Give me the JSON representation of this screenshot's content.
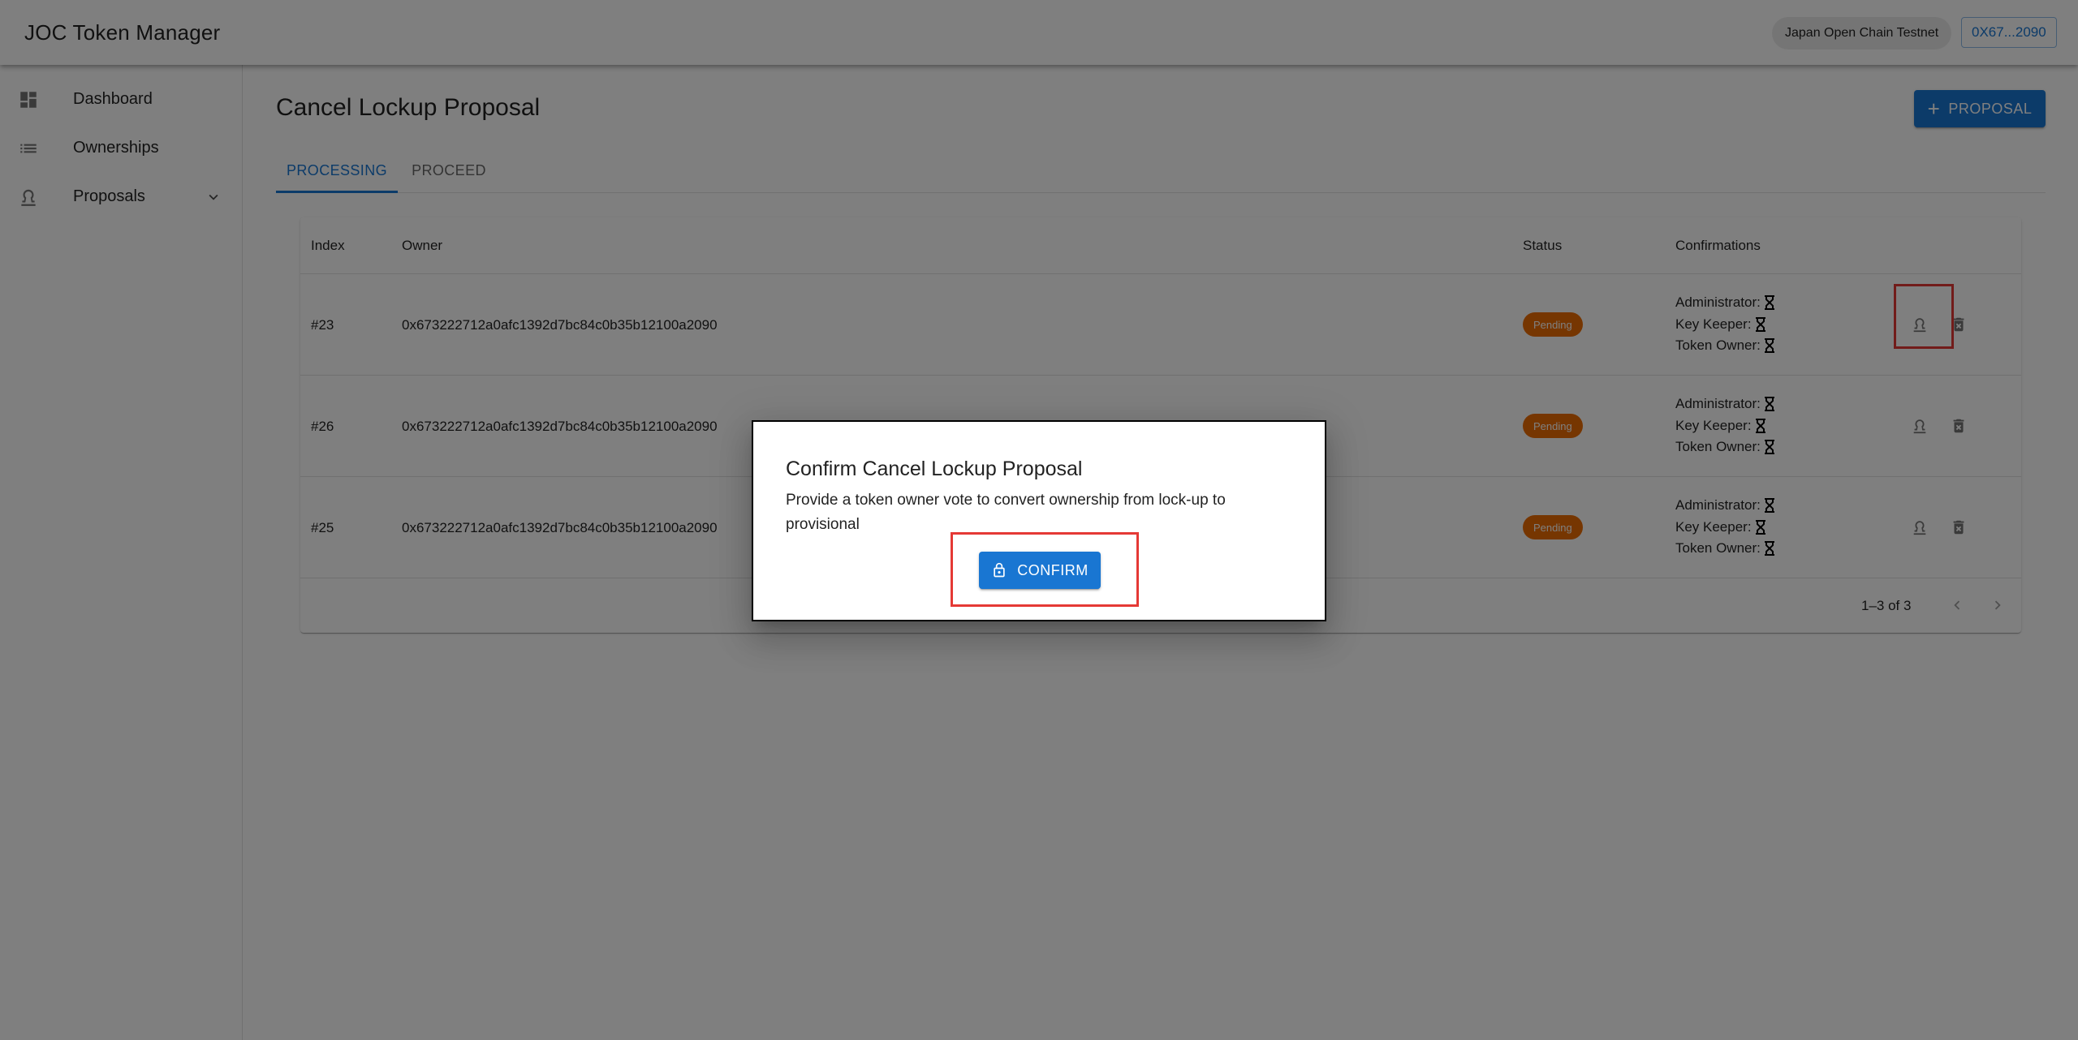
{
  "app": {
    "title": "JOC Token Manager",
    "network": "Japan Open Chain Testnet",
    "account": "0X67...2090"
  },
  "sidebar": {
    "items": [
      {
        "label": "Dashboard",
        "icon": "dashboard-icon"
      },
      {
        "label": "Ownerships",
        "icon": "list-icon"
      },
      {
        "label": "Proposals",
        "icon": "stamp-icon",
        "expand_icon": "chevron-down-icon"
      }
    ]
  },
  "page": {
    "title": "Cancel Lockup Proposal",
    "add_button": "PROPOSAL",
    "tabs": [
      {
        "label": "PROCESSING",
        "active": true
      },
      {
        "label": "PROCEED",
        "active": false
      }
    ]
  },
  "table": {
    "columns": [
      "Index",
      "Owner",
      "Status",
      "Confirmations"
    ],
    "rows": [
      {
        "index": "#23",
        "owner": "0x673222712a0afc1392d7bc84c0b35b12100a2090",
        "status": "Pending",
        "confirmations": [
          "Administrator:",
          "Key Keeper:",
          "Token Owner:"
        ]
      },
      {
        "index": "#26",
        "owner": "0x673222712a0afc1392d7bc84c0b35b12100a2090",
        "status": "Pending",
        "confirmations": [
          "Administrator:",
          "Key Keeper:",
          "Token Owner:"
        ]
      },
      {
        "index": "#25",
        "owner": "0x673222712a0afc1392d7bc84c0b35b12100a2090",
        "status": "Pending",
        "confirmations": [
          "Administrator:",
          "Key Keeper:",
          "Token Owner:"
        ]
      }
    ],
    "pagination": "1–3 of 3"
  },
  "dialog": {
    "title": "Confirm Cancel Lockup Proposal",
    "text": "Provide a token owner vote to convert ownership from lock-up to provisional",
    "confirm_label": "CONFIRM"
  },
  "colors": {
    "primary": "#1976d2",
    "pending": "#ed6c02",
    "highlight": "#e53935"
  }
}
